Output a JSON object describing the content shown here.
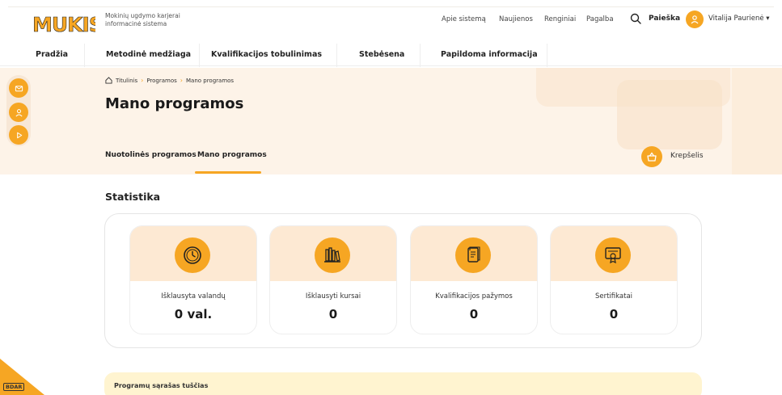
{
  "header": {
    "logo_text": "MUKIS",
    "tagline": "Mokinių ugdymo karjerai informacinė sistema",
    "links": [
      "Apie sistemą",
      "Naujienos",
      "Renginiai",
      "Pagalba"
    ],
    "search_label": "Paieška",
    "user_name": "Vitalija Paurienė ▾"
  },
  "nav": {
    "items": [
      "Pradžia",
      "Metodinė medžiaga",
      "Kvalifikacijos tobulinimas",
      "Stebėsena",
      "Papildoma informacija"
    ]
  },
  "breadcrumb": [
    "Titulinis",
    "Programos",
    "Mano programos"
  ],
  "page_title": "Mano programos",
  "tabs": [
    {
      "label": "Nuotolinės programos",
      "active": false
    },
    {
      "label": "Mano programos",
      "active": true
    }
  ],
  "cart_label": "Krepšelis",
  "stats": {
    "title": "Statistika",
    "cards": [
      {
        "icon": "clock-icon",
        "label": "Išklausyta valandų",
        "value": "0 val."
      },
      {
        "icon": "books-icon",
        "label": "Išklausyti kursai",
        "value": "0"
      },
      {
        "icon": "document-icon",
        "label": "Kvalifikacijos pažymos",
        "value": "0"
      },
      {
        "icon": "certificate-icon",
        "label": "Sertifikatai",
        "value": "0"
      }
    ]
  },
  "notice_text": "Programų sąrašas tuščias",
  "bdar_label": "BDAR",
  "colors": {
    "accent": "#f6a623",
    "hero_bg": "#fdf3e8",
    "card_top": "#fde9d3",
    "notice_bg": "#fff4d0"
  }
}
